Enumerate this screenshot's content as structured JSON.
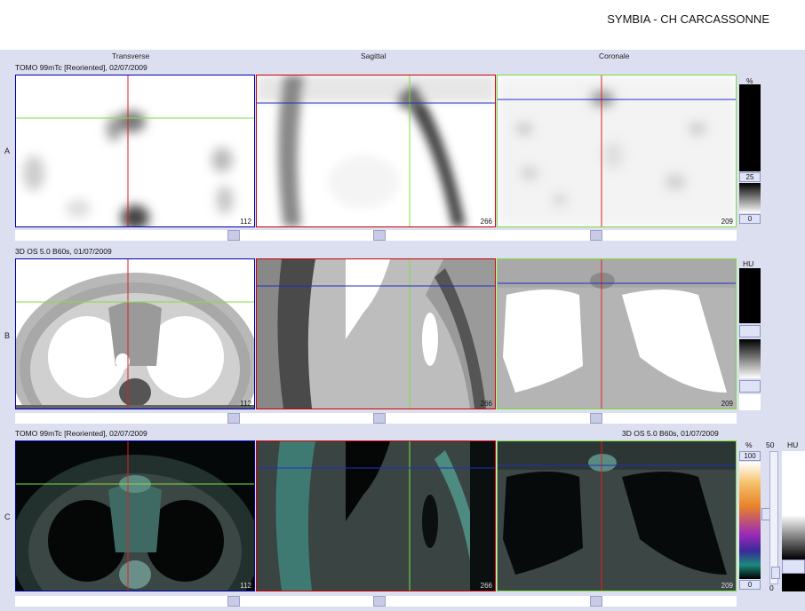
{
  "header": {
    "title": "SYMBIA - CH CARCASSONNE"
  },
  "columns": [
    "Transverse",
    "Sagittal",
    "Coronale"
  ],
  "rows": [
    {
      "letter": "A",
      "series": "TOMO 99mTc [Reoriented], 02/07/2009",
      "slices": [
        "112",
        "266",
        "209"
      ]
    },
    {
      "letter": "B",
      "series": "3D  OS  5.0  B60s, 01/07/2009",
      "slices": [
        "112",
        "266",
        "209"
      ]
    },
    {
      "letter": "C",
      "series": "TOMO 99mTc [Reoriented], 02/07/2009",
      "series_right": "3D  OS  5.0  B60s, 01/07/2009",
      "slices": [
        "112",
        "266",
        "209"
      ]
    }
  ],
  "scales": {
    "a": {
      "unit": "%",
      "upper": "25",
      "lower": "0"
    },
    "b": {
      "unit": "HU"
    },
    "c": {
      "unit": "%",
      "upper": "100",
      "lower": "0",
      "window": "50",
      "window_lower": "0",
      "unit2": "HU"
    }
  },
  "colors": {
    "transverse_frame": "#0000aa",
    "sagittal_frame": "#cc0000",
    "coronal_frame": "#7cdc3c",
    "crosshair_red": "#e02020",
    "crosshair_green": "#7ce040",
    "crosshair_blue": "#2030c0"
  }
}
